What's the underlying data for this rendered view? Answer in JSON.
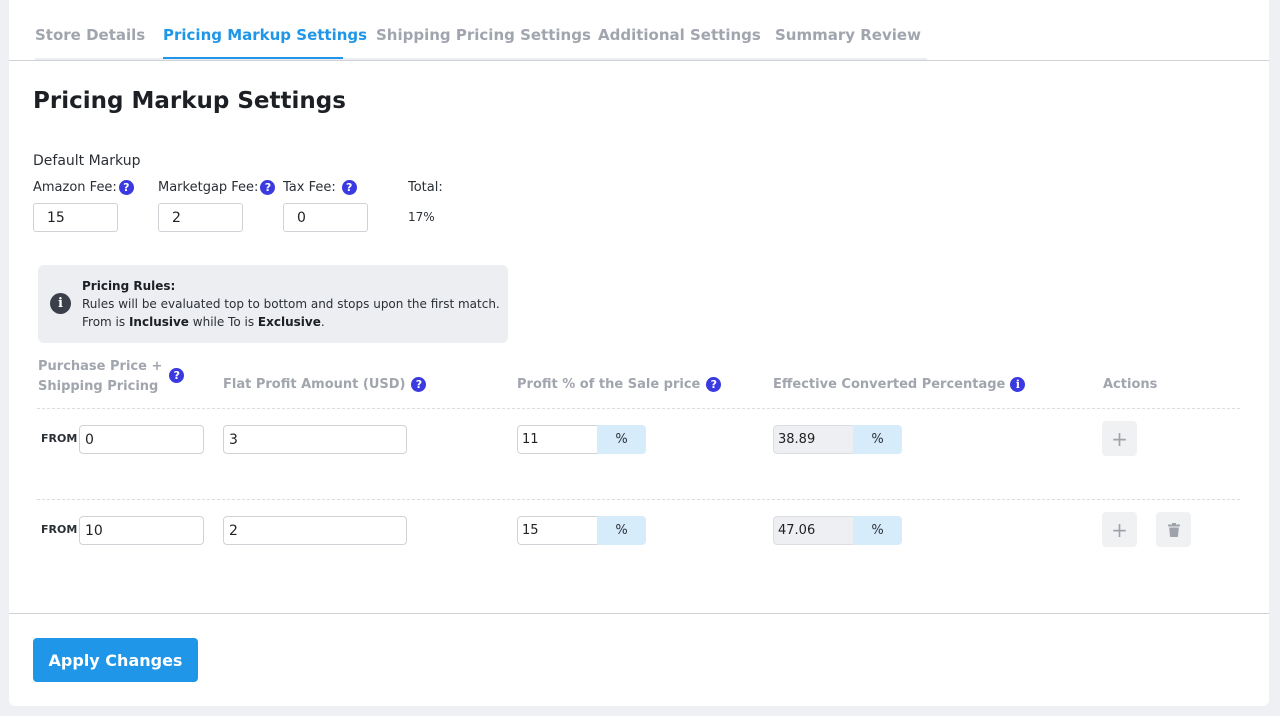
{
  "tabs": [
    {
      "label": "Store Details"
    },
    {
      "label": "Pricing Markup Settings"
    },
    {
      "label": "Shipping Pricing Settings"
    },
    {
      "label": "Additional Settings"
    },
    {
      "label": "Summary Review"
    }
  ],
  "active_tab": "Pricing Markup Settings",
  "page_title": "Pricing Markup Settings",
  "default_markup": {
    "label": "Default Markup",
    "amazon_fee": {
      "label": "Amazon Fee:",
      "value": "15"
    },
    "marketgap_fee": {
      "label": "Marketgap Fee:",
      "value": "2"
    },
    "tax_fee": {
      "label": "Tax Fee:",
      "value": "0"
    },
    "total": {
      "label": "Total:",
      "value": "17%"
    }
  },
  "info_box": {
    "title": "Pricing Rules:",
    "line1": "Rules will be evaluated top to bottom and stops upon the first match.",
    "line2_part1": "From is ",
    "line2_bold1": "Inclusive",
    "line2_part2": " while To is ",
    "line2_bold2": "Exclusive",
    "line2_part3": "."
  },
  "columns": {
    "purchase_line1": "Purchase Price +",
    "purchase_line2": "Shipping Pricing",
    "flat_profit": "Flat Profit Amount (USD)",
    "profit_pct": "Profit % of the Sale price",
    "effective": "Effective Converted Percentage",
    "actions": "Actions"
  },
  "icons": {
    "help": "?",
    "info": "i",
    "add": "+"
  },
  "rows": [
    {
      "from_label": "FROM",
      "from": "0",
      "flat_profit": "3",
      "profit_pct": "11",
      "pct_suffix": "%",
      "effective": "38.89",
      "effective_suffix": "%"
    },
    {
      "from_label": "FROM",
      "from": "10",
      "flat_profit": "2",
      "profit_pct": "15",
      "pct_suffix": "%",
      "effective": "47.06",
      "effective_suffix": "%"
    }
  ],
  "apply_button": "Apply Changes",
  "colors": {
    "accent": "#1f96e8",
    "help_icon": "#3a3ae0",
    "suffix_bg": "#d6ecfb"
  }
}
